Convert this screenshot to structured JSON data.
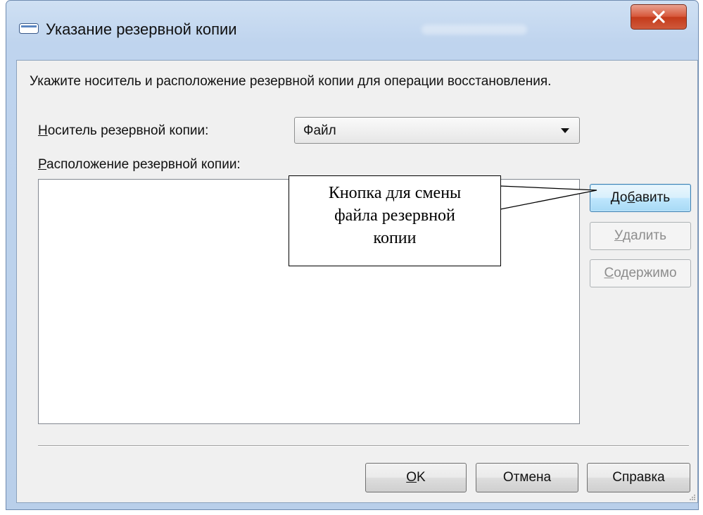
{
  "window": {
    "title": "Указание резервной копии",
    "close_symbol": "X"
  },
  "dialog": {
    "instruction": "Укажите носитель и расположение резервной копии для операции восстановления.",
    "media_label": {
      "accel": "Н",
      "rest": "оситель резервной копии:"
    },
    "media_select": {
      "value": "Файл"
    },
    "location_label": {
      "accel": "Р",
      "rest": "асположение резервной копии:"
    },
    "buttons": {
      "add": {
        "pre": "До",
        "accel": "б",
        "post": "авить",
        "enabled": true
      },
      "remove": {
        "pre": "",
        "accel": "У",
        "post": "далить",
        "enabled": false
      },
      "contents": {
        "pre": "",
        "accel": "С",
        "post": "одержимо",
        "enabled": false
      }
    },
    "footer": {
      "ok": {
        "accel": "O",
        "post": "K"
      },
      "cancel": "Отмена",
      "help": "Справка"
    }
  },
  "callout": {
    "text": "Кнопка для смены\nфайла резервной\nкопии"
  },
  "colors": {
    "accent_button_border": "#3c7fb1",
    "close_button": "#c43a1b",
    "disabled_text": "#8d8d8d"
  },
  "icons": {
    "title": "dialog-window-icon",
    "dropdown": "chevron-down-icon",
    "close": "close-icon",
    "grip": "resize-grip-icon"
  }
}
